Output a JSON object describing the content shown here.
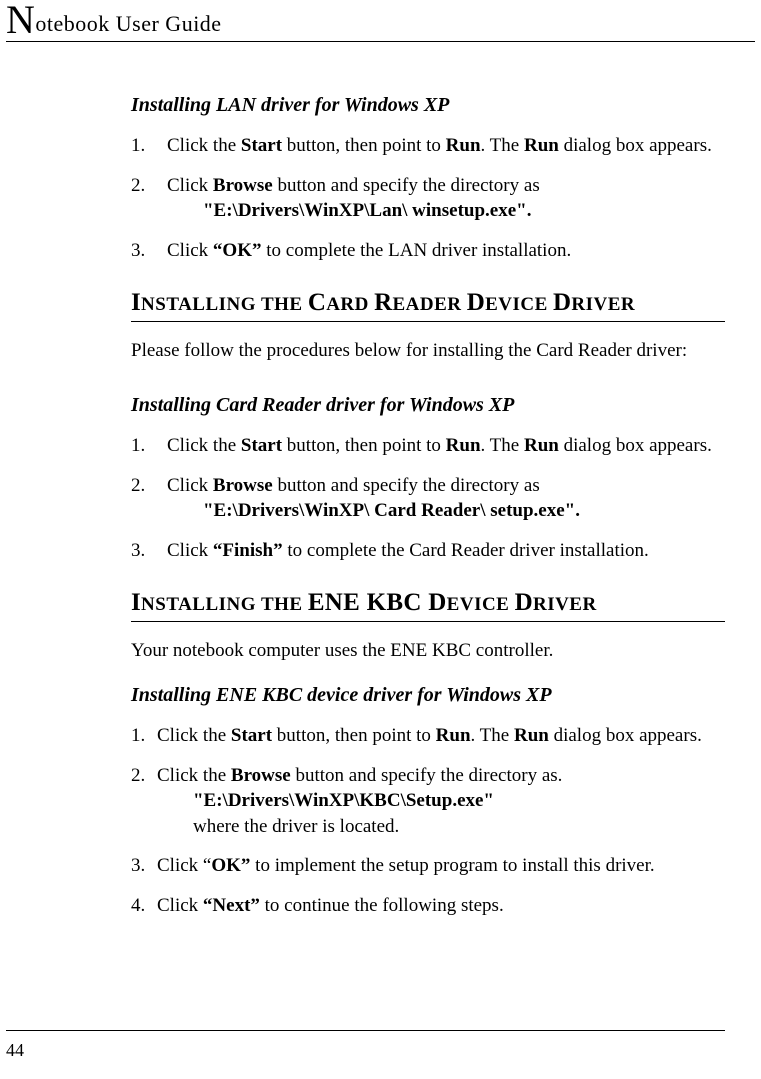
{
  "header": {
    "title": "Notebook User Guide"
  },
  "s1": {
    "subhead": "Installing LAN driver for Windows XP",
    "step1_a": "Click the ",
    "step1_b": "Start",
    "step1_c": " button, then point to ",
    "step1_d": "Run",
    "step1_e": ". The ",
    "step1_f": "Run",
    "step1_g": " dialog box appears.",
    "step2_a": "Click ",
    "step2_b": "Browse",
    "step2_c": " button and specify the directory as",
    "step2_path": "\"E:\\Drivers\\WinXP\\Lan\\ winsetup.exe\".",
    "step3_a": "Click ",
    "step3_b": "“OK”",
    "step3_c": " to complete the LAN driver installation."
  },
  "h2a": {
    "p1": "I",
    "p2": "NSTALLING THE ",
    "p3": "C",
    "p4": "ARD ",
    "p5": "R",
    "p6": "EADER ",
    "p7": "D",
    "p8": "EVICE ",
    "p9": "D",
    "p10": "RIVER"
  },
  "intro_a": "Please follow the procedures below for installing the Card Reader driver:",
  "s2": {
    "subhead": "Installing Card Reader driver for Windows XP",
    "step1_a": "Click the ",
    "step1_b": "Start",
    "step1_c": " button, then point to ",
    "step1_d": "Run",
    "step1_e": ". The ",
    "step1_f": "Run",
    "step1_g": " dialog box appears.",
    "step2_a": "Click ",
    "step2_b": "Browse",
    "step2_c": " button and specify the directory as",
    "step2_path": "\"E:\\Drivers\\WinXP\\ Card Reader\\ setup.exe\".",
    "step3_a": "Click ",
    "step3_b": "“Finish”",
    "step3_c": " to complete the Card Reader driver installation."
  },
  "h2b": {
    "p1": "I",
    "p2": "NSTALLING THE ",
    "p3": "ENE KBC D",
    "p4": "EVICE ",
    "p5": "D",
    "p6": "RIVER"
  },
  "intro_b": "Your notebook computer uses the ENE KBC controller.",
  "s3": {
    "subhead": "Installing ENE KBC device driver for Windows XP",
    "step1_a": "Click the ",
    "step1_b": "Start",
    "step1_c": " button, then point to ",
    "step1_d": "Run",
    "step1_e": ". The ",
    "step1_f": "Run",
    "step1_g": " dialog box appears.",
    "step2_a": "Click the ",
    "step2_b": "Browse",
    "step2_c": " button and specify the directory as.",
    "step2_path": "\"E:\\Drivers\\WinXP\\KBC\\Setup.exe\"",
    "step2_tail": "where the driver is located.",
    "step3_a": "Click “",
    "step3_b": "OK”",
    "step3_c": " to implement the setup program to install this driver.",
    "step4_a": "Click ",
    "step4_b": "“Next”",
    "step4_c": " to continue the following steps."
  },
  "pagenum": "44",
  "nums": {
    "n1": "1.",
    "n2": "2.",
    "n3": "3.",
    "n4": "4."
  }
}
